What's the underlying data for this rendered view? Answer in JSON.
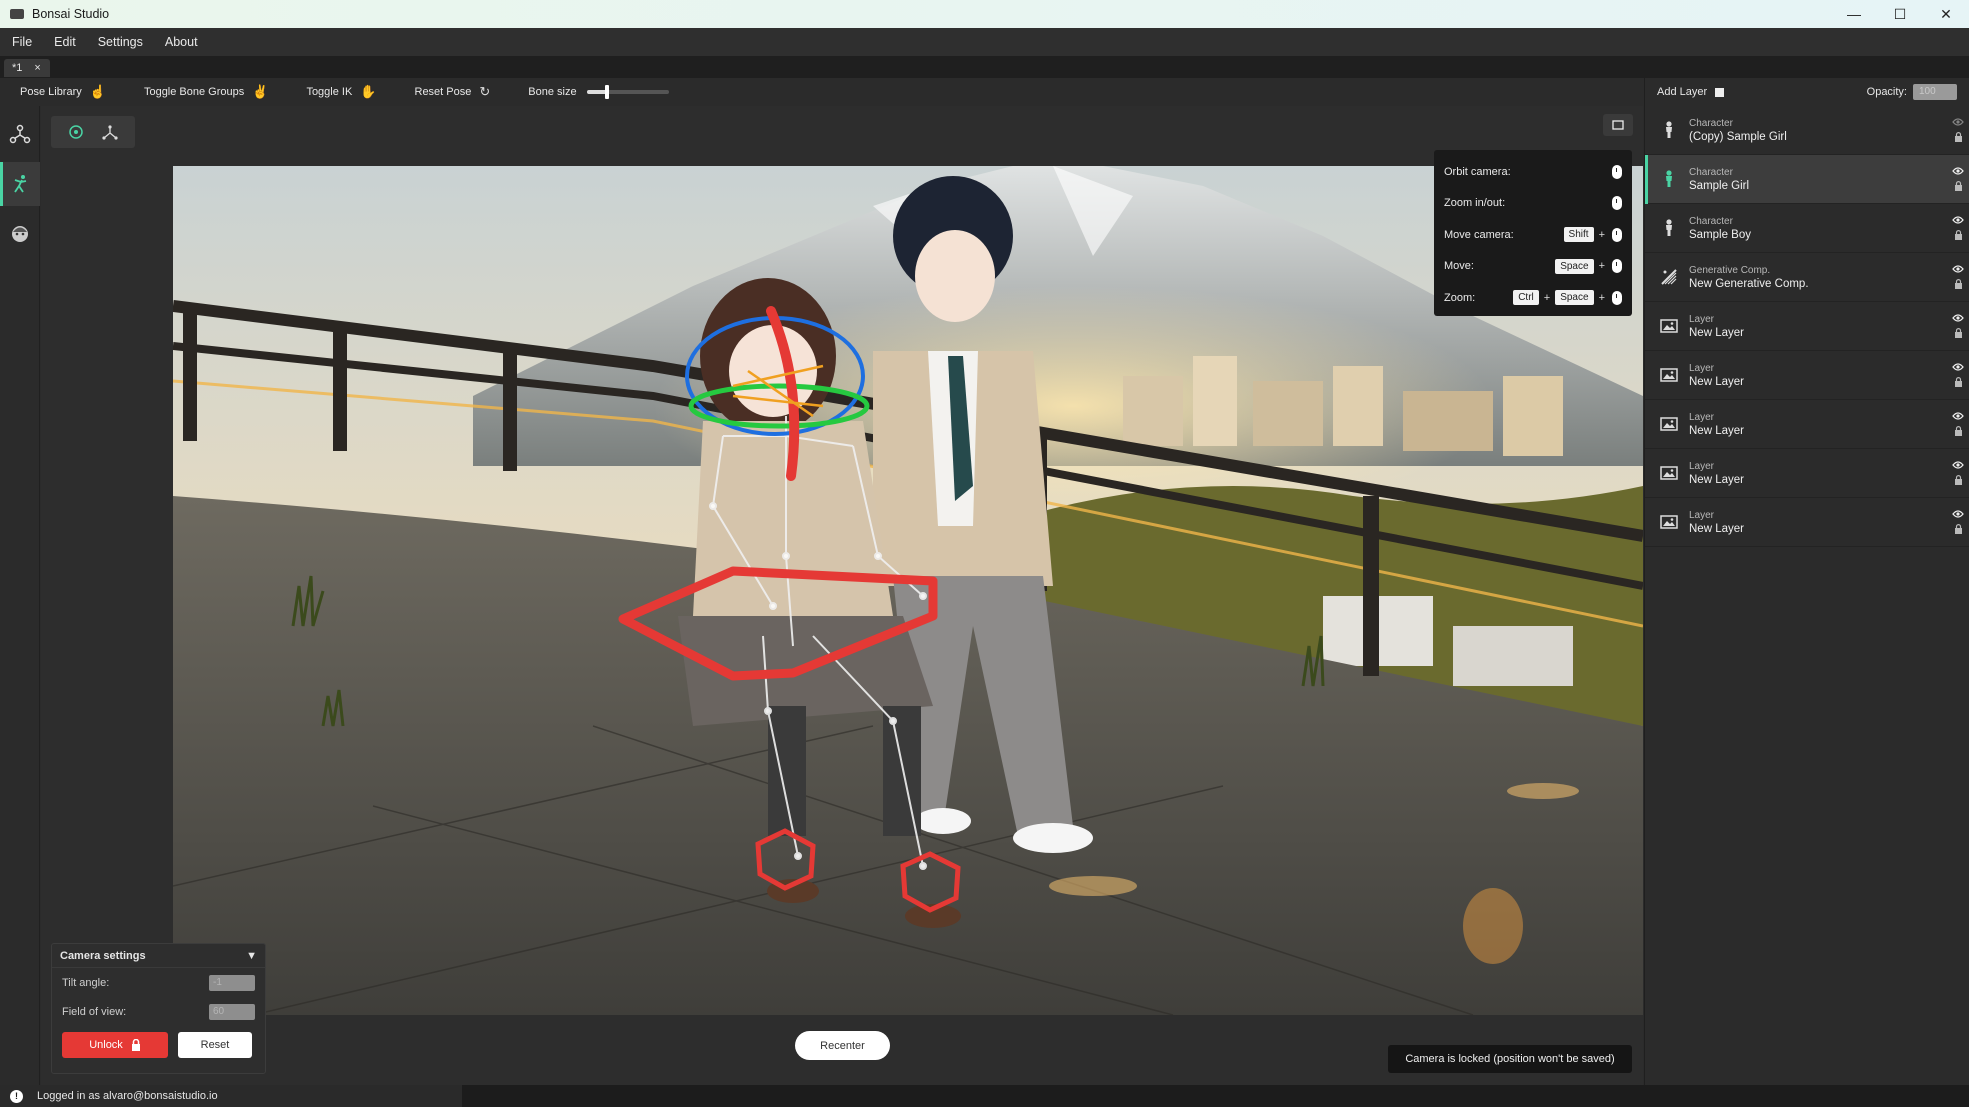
{
  "window": {
    "title": "Bonsai Studio",
    "controls": [
      "—",
      "☐",
      "✕"
    ]
  },
  "menu": [
    "File",
    "Edit",
    "Settings",
    "About"
  ],
  "tab": {
    "label": "*1",
    "close": "×"
  },
  "toolbar": {
    "pose_library": "Pose Library",
    "toggle_bone_groups": "Toggle Bone Groups",
    "toggle_ik": "Toggle IK",
    "reset_pose": "Reset Pose",
    "bone_size": "Bone size",
    "bone_size_value": 0.25
  },
  "shortcuts": {
    "orbit": "Orbit camera:",
    "zoom_inout": "Zoom in/out:",
    "move_camera": "Move camera:",
    "move": "Move:",
    "zoom": "Zoom:",
    "key_shift": "Shift",
    "key_space": "Space",
    "key_ctrl": "Ctrl",
    "plus": "+"
  },
  "camera_settings": {
    "title": "Camera settings",
    "tilt_label": "Tilt angle:",
    "tilt_value": "-1",
    "fov_label": "Field of view:",
    "fov_value": "60",
    "unlock": "Unlock",
    "reset": "Reset"
  },
  "recenter": "Recenter",
  "toast": "Camera is locked (position won't be saved)",
  "layers_panel": {
    "add_layer": "Add Layer",
    "opacity_label": "Opacity:",
    "opacity_value": "100",
    "items": [
      {
        "type": "Character",
        "name": "(Copy) Sample Girl",
        "icon": "person-icon",
        "selected": false,
        "visible": false
      },
      {
        "type": "Character",
        "name": "Sample Girl",
        "icon": "person-icon",
        "selected": true,
        "visible": true
      },
      {
        "type": "Character",
        "name": "Sample Boy",
        "icon": "person-icon",
        "selected": false,
        "visible": true
      },
      {
        "type": "Generative Comp.",
        "name": "New Generative Comp.",
        "icon": "generative-icon",
        "selected": false,
        "visible": true
      },
      {
        "type": "Layer",
        "name": "New Layer",
        "icon": "image-icon",
        "selected": false,
        "visible": true
      },
      {
        "type": "Layer",
        "name": "New Layer",
        "icon": "image-icon",
        "selected": false,
        "visible": true
      },
      {
        "type": "Layer",
        "name": "New Layer",
        "icon": "image-icon",
        "selected": false,
        "visible": true
      },
      {
        "type": "Layer",
        "name": "New Layer",
        "icon": "image-icon",
        "selected": false,
        "visible": true
      },
      {
        "type": "Layer",
        "name": "New Layer",
        "icon": "image-icon",
        "selected": false,
        "visible": true
      }
    ]
  },
  "status": {
    "user": "Logged in as alvaro@bonsaistudio.io"
  },
  "colors": {
    "accent": "#4ad4a4",
    "unlock": "#e53935",
    "bone_control": "#e53935"
  }
}
